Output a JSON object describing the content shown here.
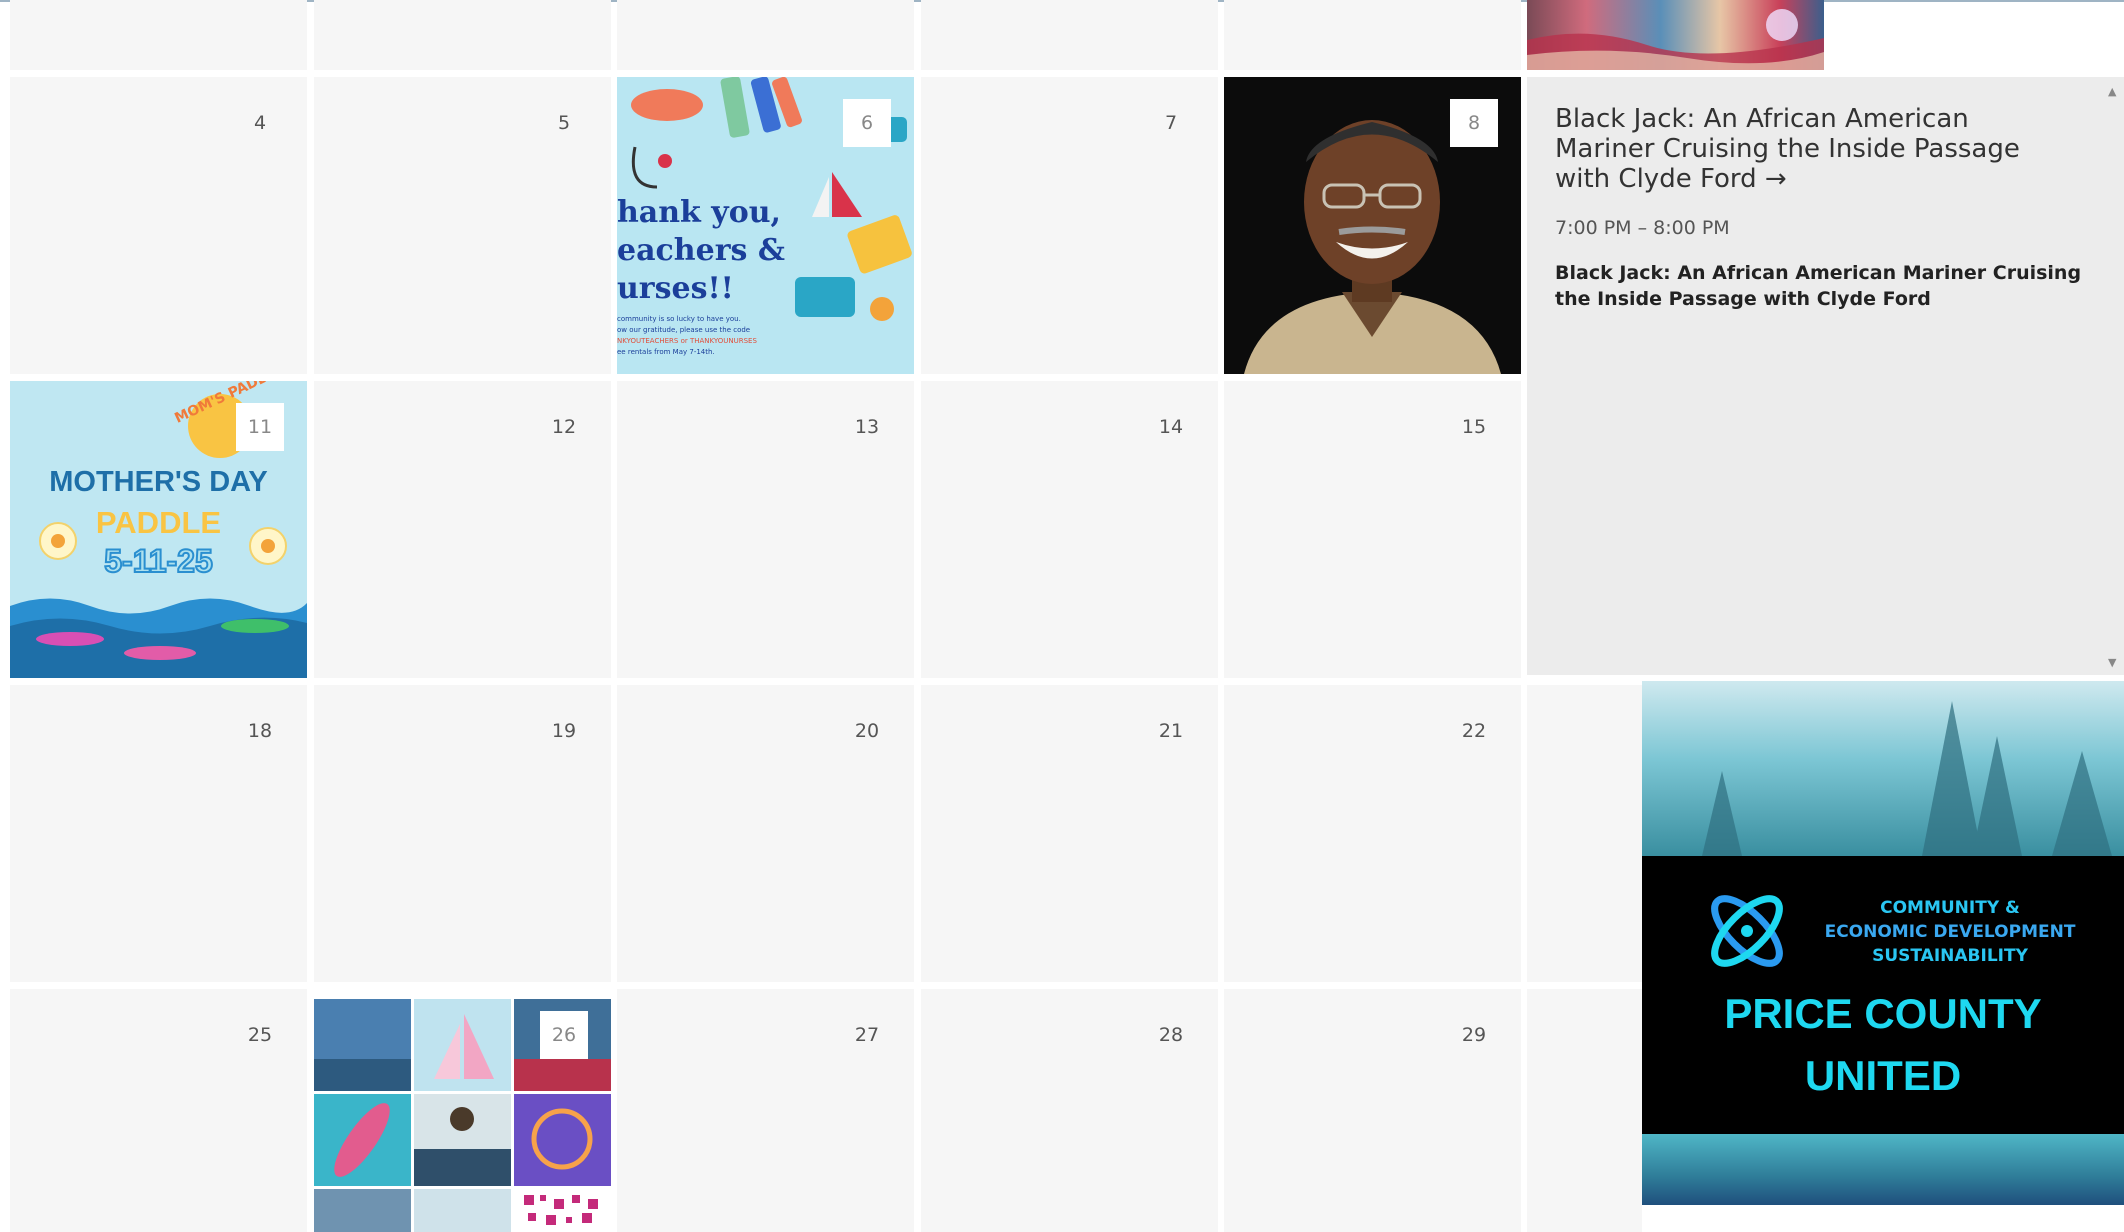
{
  "calendar": {
    "weeks": [
      {
        "days": [
          "4",
          "5",
          "6",
          "7",
          "8"
        ]
      },
      {
        "days": [
          "11",
          "12",
          "13",
          "14",
          "15"
        ]
      },
      {
        "days": [
          "18",
          "19",
          "20",
          "21",
          "22"
        ]
      },
      {
        "days": [
          "25",
          "26",
          "27",
          "28",
          "29"
        ]
      }
    ]
  },
  "event_images": {
    "thank_you": {
      "line1": "hank you,",
      "line2": "eachers &",
      "line3": "urses!!",
      "small1": "community is so lucky to have you.",
      "small2": "ow our gratitude, please use the code",
      "small3": "NKYOUTEACHERS or THANKYOUNURSES",
      "small4": "ee rentals from May 7-14th."
    },
    "mothers_day": {
      "arc": "MOM'S PADDLE",
      "title": "MOTHER'S DAY",
      "sub": "PADDLE",
      "date": "5-11-25"
    }
  },
  "detail": {
    "title": "Black Jack: An African American Mariner Cruising the Inside Passage with Clyde Ford",
    "arrow": "→",
    "time": "7:00 PM – 8:00 PM",
    "description": "Black Jack: An African American Mariner Cruising the Inside Passage with Clyde Ford"
  },
  "promo": {
    "tagline1": "COMMUNITY &",
    "tagline2": "ECONOMIC DEVELOPMENT",
    "tagline3": "SUSTAINABILITY",
    "brand1": "PRICE COUNTY",
    "brand2": "UNITED"
  },
  "colors": {
    "cell_bg": "#f6f6f6",
    "detail_bg": "#ececec",
    "brand_cyan": "#1ed8f0",
    "mothers_blue": "#1e6fa8"
  }
}
